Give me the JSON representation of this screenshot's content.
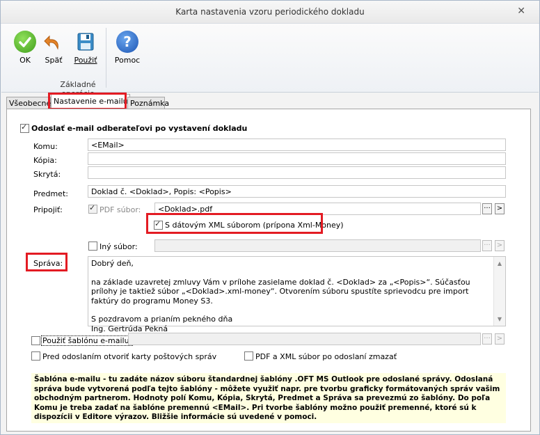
{
  "window": {
    "title": "Karta nastavenia vzoru periodického dokladu",
    "close_glyph": "✕"
  },
  "ribbon": {
    "buttons": [
      {
        "label": "OK",
        "icon": "ok-icon",
        "color": "#4caf2a"
      },
      {
        "label": "Späť",
        "icon": "undo-icon",
        "color": "#e07b1f"
      },
      {
        "label": "Použiť",
        "icon": "save-icon",
        "color": "#2f7fb8"
      },
      {
        "label": "Pomoc",
        "icon": "help-icon",
        "color": "#2d69c8"
      }
    ],
    "group_label": "Základné operácie"
  },
  "tabs": [
    "Všeobecné",
    "Nastavenie e-mailu",
    "Poznámka"
  ],
  "form": {
    "send_email_label": "Odoslať e-mail odberateľovi po vystavení dokladu",
    "to_label": "Komu:",
    "to_value": "<EMail>",
    "cc_label": "Kópia:",
    "bcc_label": "Skrytá:",
    "subject_label": "Predmet:",
    "subject_value": "Doklad č. <Doklad>, Popis: <Popis>",
    "attach_label": "Pripojiť:",
    "pdf_label": "PDF súbor:",
    "pdf_value": "<Doklad>.pdf",
    "xml_label": "S dátovým XML súborom (prípona Xml-Money)",
    "other_file_label": "Iný súbor:",
    "browse_glyph": "···",
    "arrow_glyph": ">",
    "message_label": "Správa:",
    "message_lines": [
      "Dobrý deň,",
      "",
      "na základe uzavretej zmluvy Vám v prílohe zasielame doklad č. <Doklad> za „<Popis>“. Súčasťou prílohy je taktiež súbor „<Doklad>.xml-money“. Otvorením súboru spustíte sprievodcu pre import faktúry do programu Money S3.",
      "",
      "S pozdravom a prianím pekného dňa",
      "Ing. Gertrúda Pekná"
    ],
    "use_template_label": "Použiť šablónu e-mailu:",
    "open_cards_label": "Pred odoslaním otvoriť karty poštových správ",
    "delete_files_label": "PDF a XML súbor po odoslaní zmazať",
    "info_text": "Šablóna e-mailu - tu zadáte názov súboru štandardnej šablóny .OFT MS Outlook pre odoslané správy. Odoslaná správa bude vytvorená podľa tejto šablóny - môžete využiť napr. pre tvorbu graficky formátovaných správ vašim obchodným partnerom. Hodnoty polí Komu, Kópia, Skrytá, Predmet a Správa sa prevezmú zo šablóny. Do poľa Komu je treba zadať na šablóne premennú <EMail>. Pri tvorbe šablóny možno použiť premenné, ktoré sú k dispozícii v Editore výrazov. Bližšie informácie sú uvedené v pomoci."
  }
}
